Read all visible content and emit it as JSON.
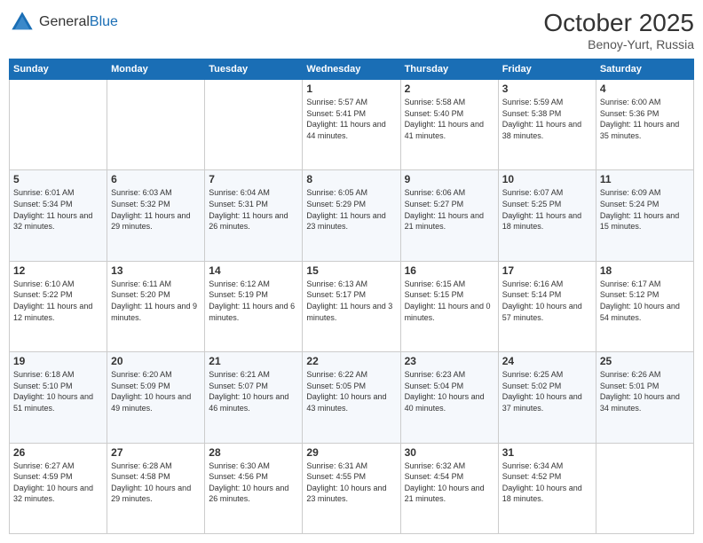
{
  "header": {
    "logo": {
      "general": "General",
      "blue": "Blue"
    },
    "month": "October 2025",
    "location": "Benoy-Yurt, Russia"
  },
  "weekdays": [
    "Sunday",
    "Monday",
    "Tuesday",
    "Wednesday",
    "Thursday",
    "Friday",
    "Saturday"
  ],
  "weeks": [
    [
      {
        "day": "",
        "sunrise": "",
        "sunset": "",
        "daylight": ""
      },
      {
        "day": "",
        "sunrise": "",
        "sunset": "",
        "daylight": ""
      },
      {
        "day": "",
        "sunrise": "",
        "sunset": "",
        "daylight": ""
      },
      {
        "day": "1",
        "sunrise": "Sunrise: 5:57 AM",
        "sunset": "Sunset: 5:41 PM",
        "daylight": "Daylight: 11 hours and 44 minutes."
      },
      {
        "day": "2",
        "sunrise": "Sunrise: 5:58 AM",
        "sunset": "Sunset: 5:40 PM",
        "daylight": "Daylight: 11 hours and 41 minutes."
      },
      {
        "day": "3",
        "sunrise": "Sunrise: 5:59 AM",
        "sunset": "Sunset: 5:38 PM",
        "daylight": "Daylight: 11 hours and 38 minutes."
      },
      {
        "day": "4",
        "sunrise": "Sunrise: 6:00 AM",
        "sunset": "Sunset: 5:36 PM",
        "daylight": "Daylight: 11 hours and 35 minutes."
      }
    ],
    [
      {
        "day": "5",
        "sunrise": "Sunrise: 6:01 AM",
        "sunset": "Sunset: 5:34 PM",
        "daylight": "Daylight: 11 hours and 32 minutes."
      },
      {
        "day": "6",
        "sunrise": "Sunrise: 6:03 AM",
        "sunset": "Sunset: 5:32 PM",
        "daylight": "Daylight: 11 hours and 29 minutes."
      },
      {
        "day": "7",
        "sunrise": "Sunrise: 6:04 AM",
        "sunset": "Sunset: 5:31 PM",
        "daylight": "Daylight: 11 hours and 26 minutes."
      },
      {
        "day": "8",
        "sunrise": "Sunrise: 6:05 AM",
        "sunset": "Sunset: 5:29 PM",
        "daylight": "Daylight: 11 hours and 23 minutes."
      },
      {
        "day": "9",
        "sunrise": "Sunrise: 6:06 AM",
        "sunset": "Sunset: 5:27 PM",
        "daylight": "Daylight: 11 hours and 21 minutes."
      },
      {
        "day": "10",
        "sunrise": "Sunrise: 6:07 AM",
        "sunset": "Sunset: 5:25 PM",
        "daylight": "Daylight: 11 hours and 18 minutes."
      },
      {
        "day": "11",
        "sunrise": "Sunrise: 6:09 AM",
        "sunset": "Sunset: 5:24 PM",
        "daylight": "Daylight: 11 hours and 15 minutes."
      }
    ],
    [
      {
        "day": "12",
        "sunrise": "Sunrise: 6:10 AM",
        "sunset": "Sunset: 5:22 PM",
        "daylight": "Daylight: 11 hours and 12 minutes."
      },
      {
        "day": "13",
        "sunrise": "Sunrise: 6:11 AM",
        "sunset": "Sunset: 5:20 PM",
        "daylight": "Daylight: 11 hours and 9 minutes."
      },
      {
        "day": "14",
        "sunrise": "Sunrise: 6:12 AM",
        "sunset": "Sunset: 5:19 PM",
        "daylight": "Daylight: 11 hours and 6 minutes."
      },
      {
        "day": "15",
        "sunrise": "Sunrise: 6:13 AM",
        "sunset": "Sunset: 5:17 PM",
        "daylight": "Daylight: 11 hours and 3 minutes."
      },
      {
        "day": "16",
        "sunrise": "Sunrise: 6:15 AM",
        "sunset": "Sunset: 5:15 PM",
        "daylight": "Daylight: 11 hours and 0 minutes."
      },
      {
        "day": "17",
        "sunrise": "Sunrise: 6:16 AM",
        "sunset": "Sunset: 5:14 PM",
        "daylight": "Daylight: 10 hours and 57 minutes."
      },
      {
        "day": "18",
        "sunrise": "Sunrise: 6:17 AM",
        "sunset": "Sunset: 5:12 PM",
        "daylight": "Daylight: 10 hours and 54 minutes."
      }
    ],
    [
      {
        "day": "19",
        "sunrise": "Sunrise: 6:18 AM",
        "sunset": "Sunset: 5:10 PM",
        "daylight": "Daylight: 10 hours and 51 minutes."
      },
      {
        "day": "20",
        "sunrise": "Sunrise: 6:20 AM",
        "sunset": "Sunset: 5:09 PM",
        "daylight": "Daylight: 10 hours and 49 minutes."
      },
      {
        "day": "21",
        "sunrise": "Sunrise: 6:21 AM",
        "sunset": "Sunset: 5:07 PM",
        "daylight": "Daylight: 10 hours and 46 minutes."
      },
      {
        "day": "22",
        "sunrise": "Sunrise: 6:22 AM",
        "sunset": "Sunset: 5:05 PM",
        "daylight": "Daylight: 10 hours and 43 minutes."
      },
      {
        "day": "23",
        "sunrise": "Sunrise: 6:23 AM",
        "sunset": "Sunset: 5:04 PM",
        "daylight": "Daylight: 10 hours and 40 minutes."
      },
      {
        "day": "24",
        "sunrise": "Sunrise: 6:25 AM",
        "sunset": "Sunset: 5:02 PM",
        "daylight": "Daylight: 10 hours and 37 minutes."
      },
      {
        "day": "25",
        "sunrise": "Sunrise: 6:26 AM",
        "sunset": "Sunset: 5:01 PM",
        "daylight": "Daylight: 10 hours and 34 minutes."
      }
    ],
    [
      {
        "day": "26",
        "sunrise": "Sunrise: 6:27 AM",
        "sunset": "Sunset: 4:59 PM",
        "daylight": "Daylight: 10 hours and 32 minutes."
      },
      {
        "day": "27",
        "sunrise": "Sunrise: 6:28 AM",
        "sunset": "Sunset: 4:58 PM",
        "daylight": "Daylight: 10 hours and 29 minutes."
      },
      {
        "day": "28",
        "sunrise": "Sunrise: 6:30 AM",
        "sunset": "Sunset: 4:56 PM",
        "daylight": "Daylight: 10 hours and 26 minutes."
      },
      {
        "day": "29",
        "sunrise": "Sunrise: 6:31 AM",
        "sunset": "Sunset: 4:55 PM",
        "daylight": "Daylight: 10 hours and 23 minutes."
      },
      {
        "day": "30",
        "sunrise": "Sunrise: 6:32 AM",
        "sunset": "Sunset: 4:54 PM",
        "daylight": "Daylight: 10 hours and 21 minutes."
      },
      {
        "day": "31",
        "sunrise": "Sunrise: 6:34 AM",
        "sunset": "Sunset: 4:52 PM",
        "daylight": "Daylight: 10 hours and 18 minutes."
      },
      {
        "day": "",
        "sunrise": "",
        "sunset": "",
        "daylight": ""
      }
    ]
  ]
}
